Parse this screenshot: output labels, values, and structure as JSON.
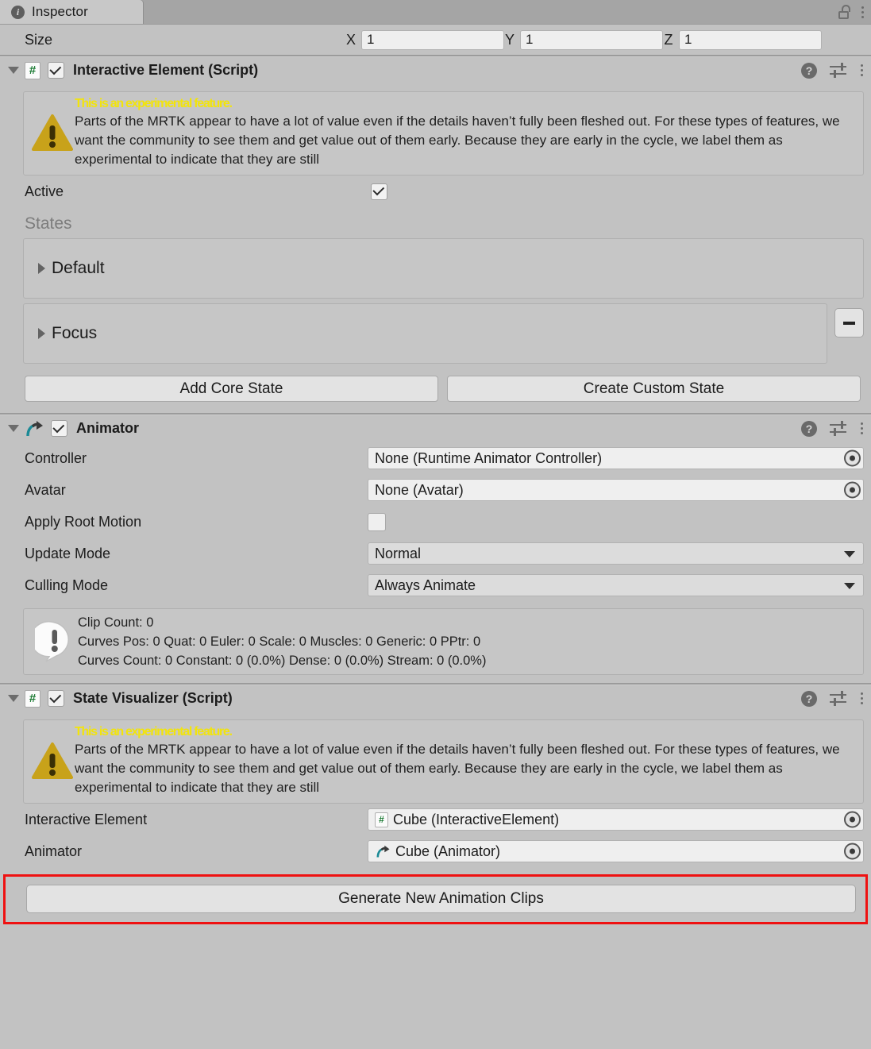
{
  "window": {
    "tab_label": "Inspector",
    "tab_icon": "info-circle-icon",
    "lock_icon": "unlocked-padlock-icon",
    "menu_icon": "kebab-menu-icon"
  },
  "size_row": {
    "label": "Size",
    "axes": [
      {
        "letter": "X",
        "value": "1"
      },
      {
        "letter": "Y",
        "value": "1"
      },
      {
        "letter": "Z",
        "value": "1"
      }
    ]
  },
  "experimental_warning": {
    "title": "This is an experimental feature.",
    "body": "Parts of the MRTK appear to have a lot of value even if the details haven’t fully been fleshed out. For these types of features, we want the community to see them and get value out of them early. Because they are early in the cycle, we label them as experimental to indicate that they are still"
  },
  "interactive_element": {
    "title": "Interactive Element (Script)",
    "enabled": true,
    "icon": "script-icon",
    "help_icon": "help-icon",
    "preset_icon": "preset-sliders-icon",
    "menu_icon": "kebab-menu-icon",
    "active": {
      "label": "Active",
      "checked": true
    },
    "states_header": "States",
    "states": [
      {
        "name": "Default",
        "removable": false
      },
      {
        "name": "Focus",
        "removable": true
      }
    ],
    "buttons": {
      "add_core_state": "Add Core State",
      "create_custom_state": "Create Custom State"
    }
  },
  "animator": {
    "title": "Animator",
    "enabled": true,
    "icon": "animator-arrow-icon",
    "fields": [
      {
        "label": "Controller",
        "value": "None (Runtime Animator Controller)",
        "type": "object"
      },
      {
        "label": "Avatar",
        "value": "None (Avatar)",
        "type": "object"
      },
      {
        "label": "Apply Root Motion",
        "value": "",
        "type": "checkbox",
        "checked": false
      },
      {
        "label": "Update Mode",
        "value": "Normal",
        "type": "dropdown"
      },
      {
        "label": "Culling Mode",
        "value": "Always Animate",
        "type": "dropdown"
      }
    ],
    "stats": {
      "line1": "Clip Count: 0",
      "line2": "Curves Pos: 0 Quat: 0 Euler: 0 Scale: 0 Muscles: 0 Generic: 0 PPtr: 0",
      "line3": "Curves Count: 0 Constant: 0 (0.0%) Dense: 0 (0.0%) Stream: 0 (0.0%)"
    }
  },
  "state_visualizer": {
    "title": "State Visualizer (Script)",
    "enabled": true,
    "icon": "script-icon",
    "references": [
      {
        "label": "Interactive Element",
        "value": "Cube (InteractiveElement)",
        "icon": "script-icon"
      },
      {
        "label": "Animator",
        "value": "Cube (Animator)",
        "icon": "animator-arrow-icon"
      }
    ],
    "generate_button": {
      "label": "Generate New Animation Clips",
      "highlight_color": "#ef1111"
    }
  },
  "colors": {
    "panel_bg": "#c2c2c2",
    "tabbar_bg": "#a5a5a5",
    "field_bg": "#efefef",
    "warn_yellow": "#f2e40c",
    "warn_triangle": "#c8a21a",
    "script_green": "#1a7a32",
    "highlight_red": "#ef1111"
  }
}
